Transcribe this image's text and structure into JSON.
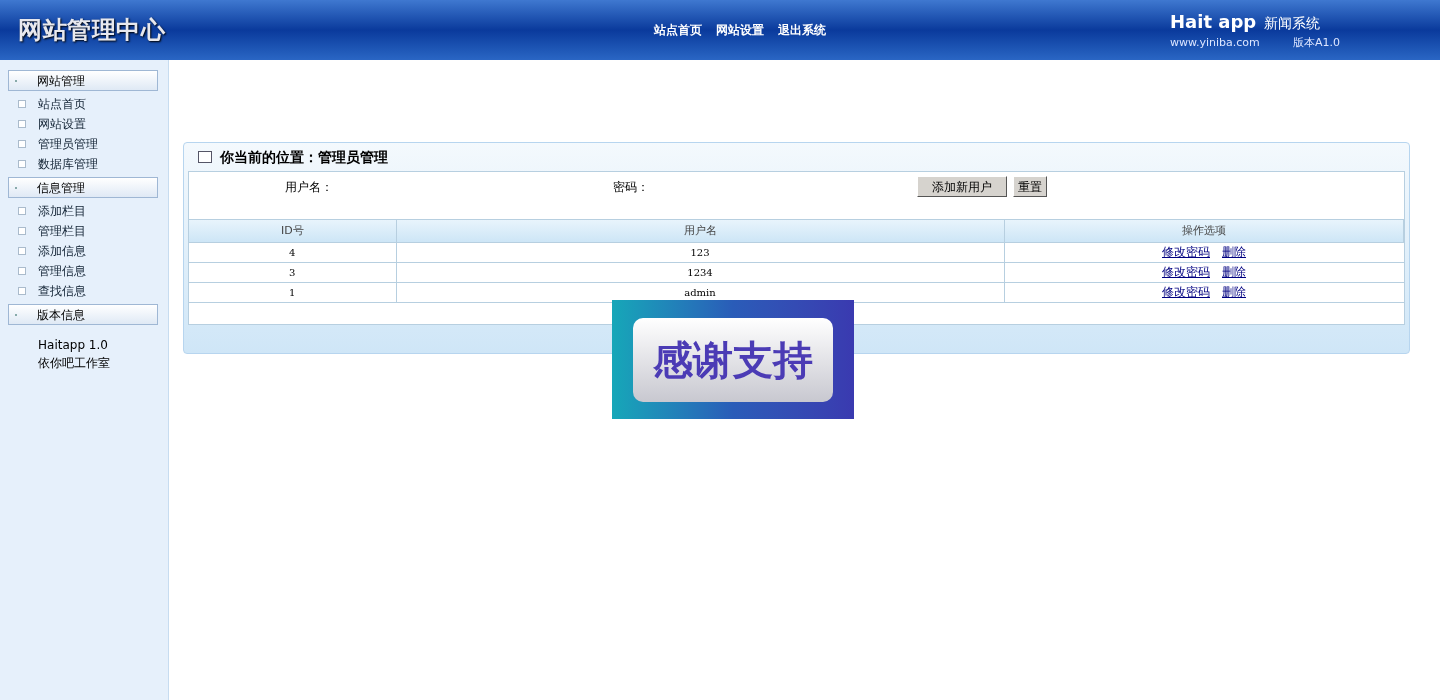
{
  "header": {
    "title": "网站管理中心",
    "nav": [
      "站点首页",
      "网站设置",
      "退出系统"
    ],
    "brand": {
      "name": "Hait app",
      "product": "新闻系统",
      "url": "www.yiniba.com",
      "version": "版本A1.0"
    }
  },
  "sidebar": {
    "groups": [
      {
        "title": "网站管理",
        "items": [
          "站点首页",
          "网站设置",
          "管理员管理",
          "数据库管理"
        ]
      },
      {
        "title": "信息管理",
        "items": [
          "添加栏目",
          "管理栏目",
          "添加信息",
          "管理信息",
          "查找信息"
        ]
      },
      {
        "title": "版本信息",
        "lines": [
          "Haitapp 1.0",
          "依你吧工作室"
        ]
      }
    ]
  },
  "panel": {
    "title": "你当前的位置：管理员管理",
    "form": {
      "username_label": "用户名：",
      "password_label": "密码：",
      "buttons": [
        "添加新用户",
        "重置"
      ]
    },
    "table": {
      "columns": [
        "ID号",
        "用户名",
        "操作选项"
      ],
      "rows": [
        {
          "id": "4",
          "username": "123",
          "actions": [
            "修改密码",
            "删除"
          ]
        },
        {
          "id": "3",
          "username": "1234",
          "actions": [
            "修改密码",
            "删除"
          ]
        },
        {
          "id": "1",
          "username": "admin",
          "actions": [
            "修改密码",
            "删除"
          ]
        }
      ]
    }
  },
  "overlay_banner": {
    "text": "感谢支持"
  }
}
